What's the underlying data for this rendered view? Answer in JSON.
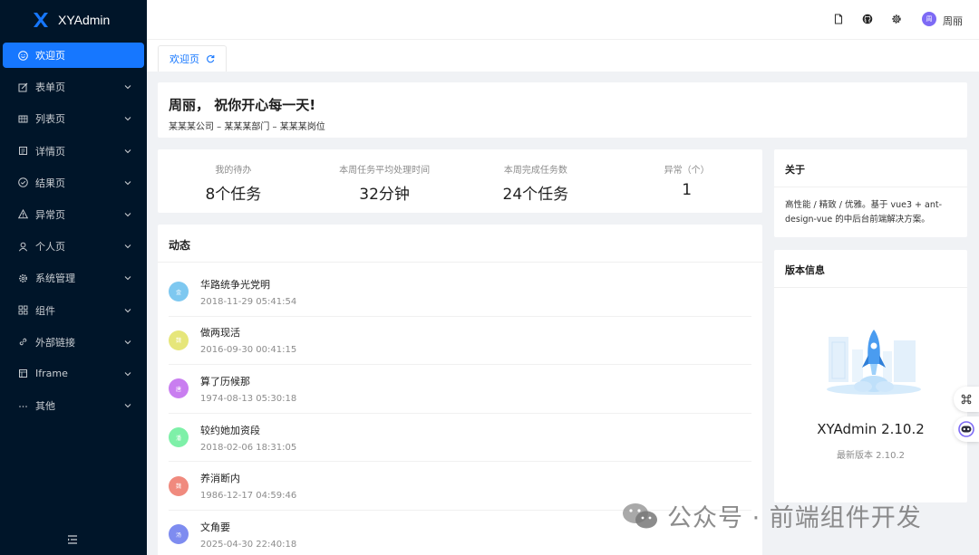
{
  "app": {
    "name": "XYAdmin"
  },
  "sidebar": {
    "items": [
      {
        "label": "欢迎页",
        "icon": "smile-icon",
        "active": true,
        "has_arrow": false
      },
      {
        "label": "表单页",
        "icon": "form-icon",
        "has_arrow": true
      },
      {
        "label": "列表页",
        "icon": "table-icon",
        "has_arrow": true
      },
      {
        "label": "详情页",
        "icon": "profile-icon",
        "has_arrow": true
      },
      {
        "label": "结果页",
        "icon": "check-circle-icon",
        "has_arrow": true
      },
      {
        "label": "异常页",
        "icon": "warning-icon",
        "has_arrow": true
      },
      {
        "label": "个人页",
        "icon": "user-icon",
        "has_arrow": true
      },
      {
        "label": "系统管理",
        "icon": "gear-icon",
        "has_arrow": true
      },
      {
        "label": "组件",
        "icon": "appstore-icon",
        "has_arrow": true
      },
      {
        "label": "外部链接",
        "icon": "link-icon",
        "has_arrow": true
      },
      {
        "label": "Iframe",
        "icon": "iframe-icon",
        "has_arrow": true
      },
      {
        "label": "其他",
        "icon": "ellipsis-icon",
        "has_arrow": true
      }
    ]
  },
  "header": {
    "user": {
      "name": "周丽",
      "avatar_text": "周",
      "avatar_color": "#7d6af5"
    }
  },
  "tabs": [
    {
      "label": "欢迎页"
    }
  ],
  "welcome": {
    "title": "周丽， 祝你开心每一天!",
    "subtitle": "某某某公司 – 某某某部门 – 某某某岗位"
  },
  "stats": [
    {
      "label": "我的待办",
      "value": "8个任务"
    },
    {
      "label": "本周任务平均处理时间",
      "value": "32分钟"
    },
    {
      "label": "本周完成任务数",
      "value": "24个任务"
    },
    {
      "label": "异常（个）",
      "value": "1"
    }
  ],
  "feed": {
    "title": "动态",
    "items": [
      {
        "avatar": "金",
        "color": "#7ec8f0",
        "title": "华路统争光党明",
        "time": "2018-11-29 05:41:54"
      },
      {
        "avatar": "魏",
        "color": "#e6e67a",
        "title": "做两现活",
        "time": "2016-09-30 00:41:15"
      },
      {
        "avatar": "唐",
        "color": "#c97ef0",
        "title": "算了历候那",
        "time": "1974-08-13 05:30:18"
      },
      {
        "avatar": "潘",
        "color": "#7ef0a8",
        "title": "较约她加资段",
        "time": "2018-02-06 18:31:05"
      },
      {
        "avatar": "魏",
        "color": "#f08a7e",
        "title": "养消断内",
        "time": "1986-12-17 04:59:46"
      },
      {
        "avatar": "汤",
        "color": "#7e8cf0",
        "title": "文角要",
        "time": "2025-04-30 22:40:18"
      }
    ]
  },
  "about": {
    "title": "关于",
    "text": "高性能 / 精致 / 优雅。基于 vue3 + ant-design-vue 的中后台前端解决方案。"
  },
  "version": {
    "title": "版本信息",
    "name": "XYAdmin 2.10.2",
    "latest": "最新版本 2.10.2"
  },
  "watermark": {
    "text": "公众号 · 前端组件开发"
  }
}
